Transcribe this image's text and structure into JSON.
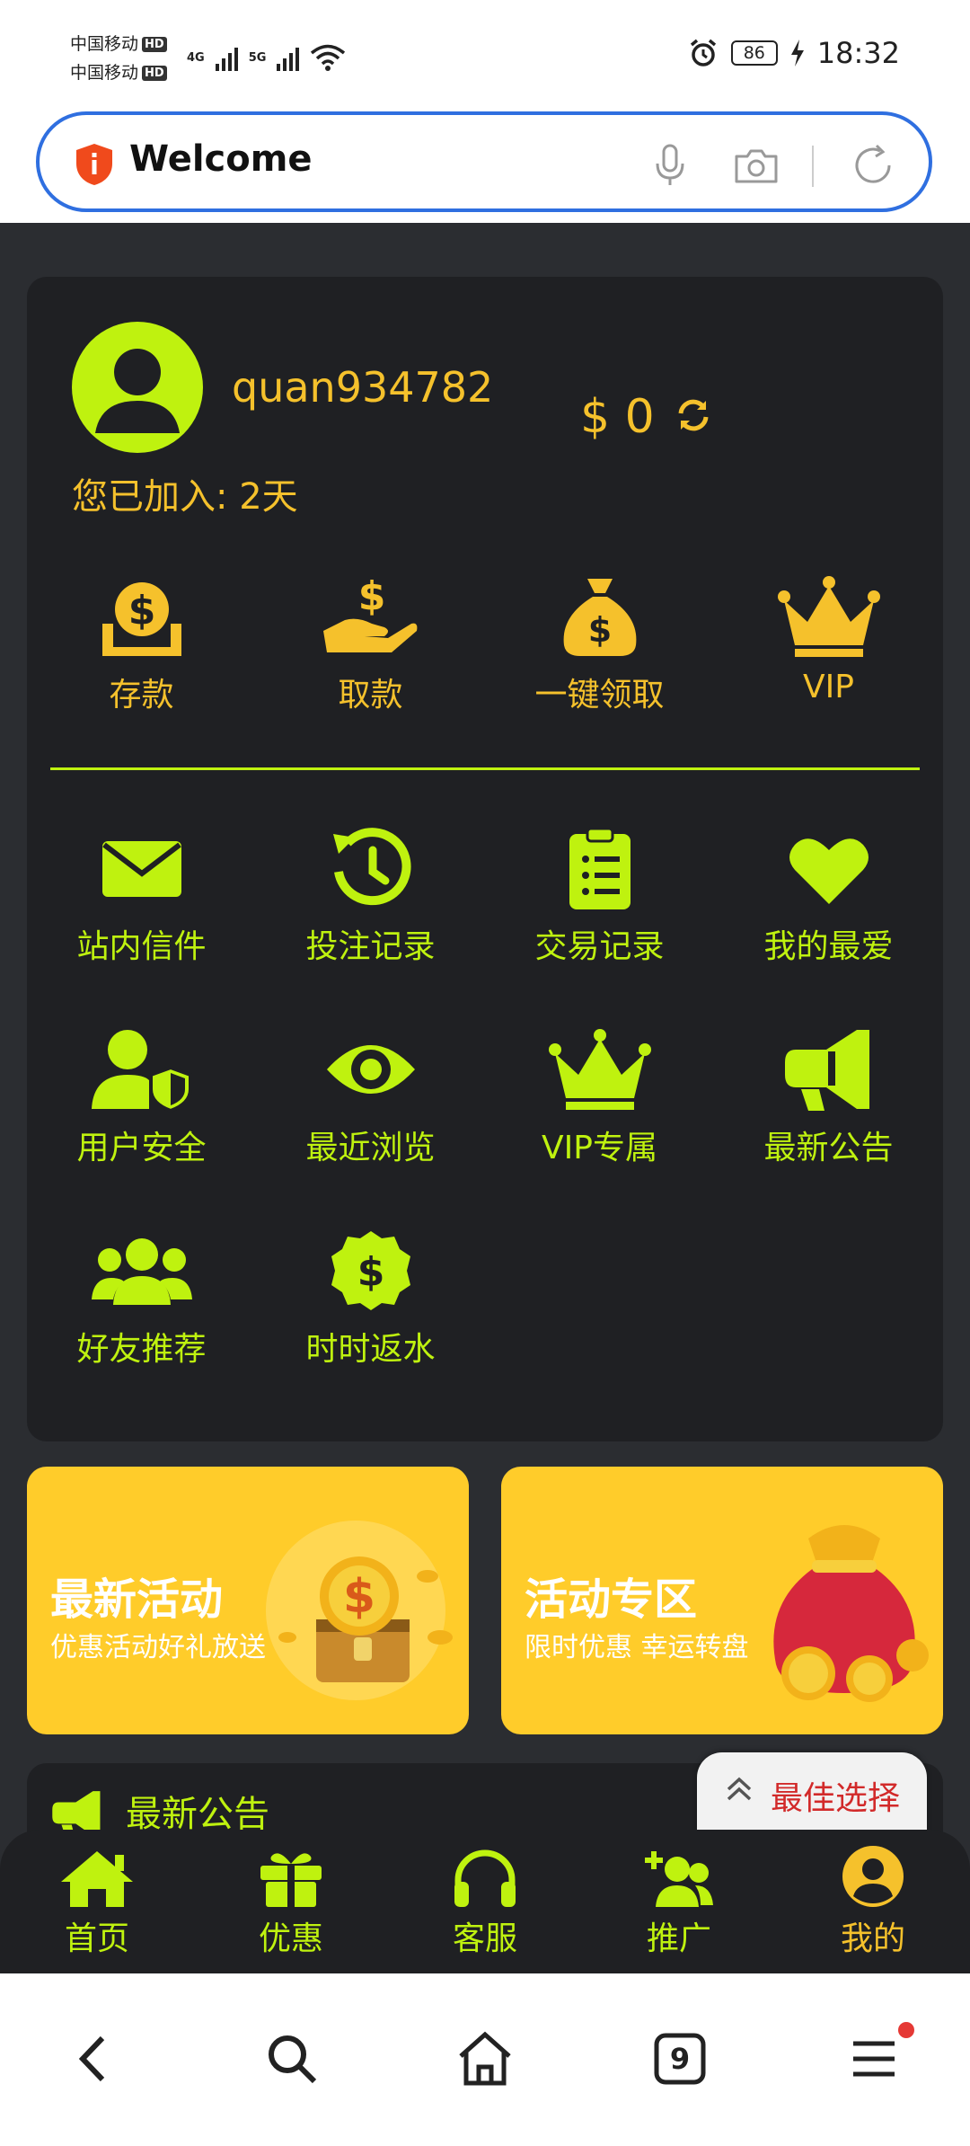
{
  "status_bar": {
    "carrier1": "中国移动",
    "carrier2": "中国移动",
    "hd": "HD",
    "net1": "4G",
    "net2": "5G",
    "battery": "86",
    "time": "18:32"
  },
  "address_bar": {
    "text": "Welcome"
  },
  "profile": {
    "username": "quan934782",
    "balance": "$ 0",
    "joined": "您已加入: 2天"
  },
  "quick_actions": [
    {
      "label": "存款",
      "icon": "deposit-icon"
    },
    {
      "label": "取款",
      "icon": "withdraw-icon"
    },
    {
      "label": "一键领取",
      "icon": "money-bag-icon"
    },
    {
      "label": "VIP",
      "icon": "crown-icon"
    }
  ],
  "menu": [
    {
      "label": "站内信件",
      "icon": "mail-icon"
    },
    {
      "label": "投注记录",
      "icon": "history-icon"
    },
    {
      "label": "交易记录",
      "icon": "clipboard-icon"
    },
    {
      "label": "我的最爱",
      "icon": "heart-icon"
    },
    {
      "label": "用户安全",
      "icon": "user-shield-icon"
    },
    {
      "label": "最近浏览",
      "icon": "eye-icon"
    },
    {
      "label": "VIP专属",
      "icon": "crown-icon"
    },
    {
      "label": "最新公告",
      "icon": "megaphone-icon"
    },
    {
      "label": "好友推荐",
      "icon": "users-icon"
    },
    {
      "label": "时时返水",
      "icon": "dollar-badge-icon"
    }
  ],
  "promos": [
    {
      "title": "最新活动",
      "subtitle": "优惠活动好礼放送"
    },
    {
      "title": "活动专区",
      "subtitle": "限时优惠 幸运转盘"
    }
  ],
  "announcement": {
    "title": "最新公告"
  },
  "best_choice": {
    "label": "最佳选择"
  },
  "bottom_nav": [
    {
      "label": "首页",
      "icon": "home-icon"
    },
    {
      "label": "优惠",
      "icon": "gift-icon"
    },
    {
      "label": "客服",
      "icon": "headset-icon"
    },
    {
      "label": "推广",
      "icon": "user-plus-icon"
    },
    {
      "label": "我的",
      "icon": "user-circle-icon"
    }
  ],
  "browser_bar": {
    "tabs_count": "9"
  },
  "colors": {
    "lime": "#bff20f",
    "gold": "#f5c12c",
    "panel": "#1f2023",
    "background": "#2b2d31",
    "promo": "#ffcc2a"
  }
}
